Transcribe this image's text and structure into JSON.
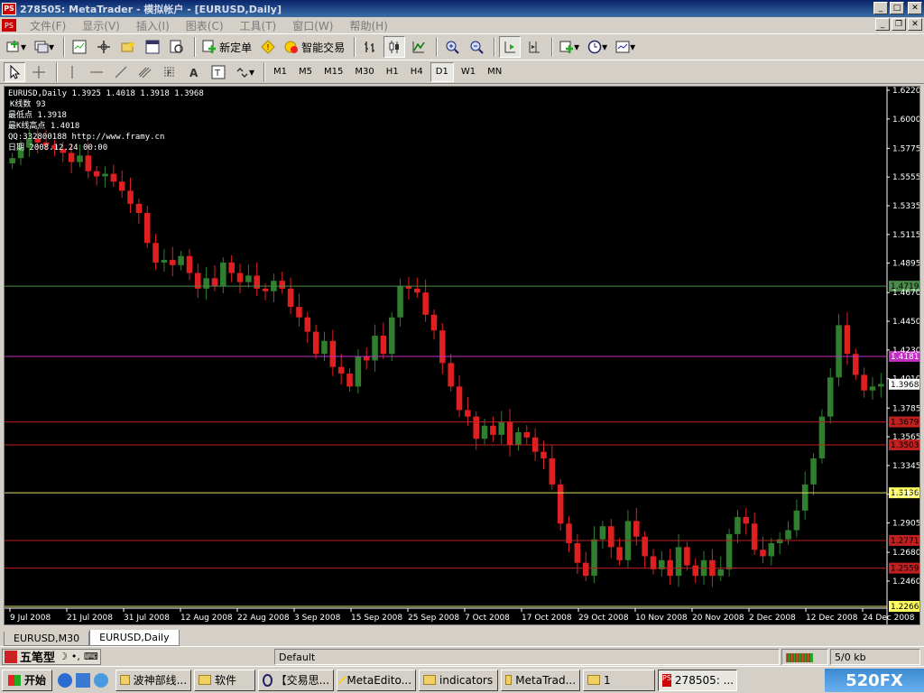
{
  "window": {
    "title": "278505: MetaTrader - 模拟帐户 - [EURUSD,Daily]",
    "app_badge": "PS"
  },
  "menu": [
    "文件(F)",
    "显示(V)",
    "插入(I)",
    "图表(C)",
    "工具(T)",
    "窗口(W)",
    "帮助(H)"
  ],
  "toolbar": {
    "new_order_label": "新定单",
    "expert_label": "智能交易"
  },
  "timeframes": [
    "M1",
    "M5",
    "M15",
    "M30",
    "H1",
    "H4",
    "D1",
    "W1",
    "MN"
  ],
  "active_timeframe": "D1",
  "chart_info": {
    "line1": "EURUSD,Daily  1.3925 1.4018 1.3918 1.3968",
    "line2": "K线数   93",
    "line3": " 最低点 1.3918",
    "line4": " 最K线高点 1.4018",
    "line5": "QQ:332800188 http://www.framy.cn",
    "line6": "日期 2008.12.24 00:00"
  },
  "price_axis": [
    "1.6220",
    "1.6000",
    "1.5775",
    "1.5555",
    "1.5335",
    "1.5115",
    "1.4895",
    "1.4670",
    "1.4450",
    "1.4230",
    "1.4010",
    "1.3785",
    "1.3565",
    "1.3345",
    "1.3125",
    "1.2905",
    "1.2680",
    "1.2460"
  ],
  "date_axis": [
    "9 Jul 2008",
    "21 Jul 2008",
    "31 Jul 2008",
    "12 Aug 2008",
    "22 Aug 2008",
    "3 Sep 2008",
    "15 Sep 2008",
    "25 Sep 2008",
    "7 Oct 2008",
    "17 Oct 2008",
    "29 Oct 2008",
    "10 Nov 2008",
    "20 Nov 2008",
    "2 Dec 2008",
    "12 Dec 2008",
    "24 Dec 2008"
  ],
  "levels": [
    {
      "price": "1.4719",
      "color": "#4a8a4a",
      "label_bg": "#4a8a4a",
      "label_fg": "#000"
    },
    {
      "price": "1.4181",
      "color": "#c030c0",
      "label_bg": "#c030c0",
      "label_fg": "#fff"
    },
    {
      "price": "1.3679",
      "color": "#c02020",
      "label_bg": "#c02020",
      "label_fg": "#000"
    },
    {
      "price": "1.3503",
      "color": "#c02020",
      "label_bg": "#c02020",
      "label_fg": "#000"
    },
    {
      "price": "1.3136",
      "color": "#e0e060",
      "label_bg": "#ffff60",
      "label_fg": "#000"
    },
    {
      "price": "1.2771",
      "color": "#c02020",
      "label_bg": "#c02020",
      "label_fg": "#000"
    },
    {
      "price": "1.2559",
      "color": "#c02020",
      "label_bg": "#c02020",
      "label_fg": "#000"
    },
    {
      "price": "1.2266",
      "color": "#e0e060",
      "label_bg": "#ffff60",
      "label_fg": "#000"
    }
  ],
  "current_price": "1.3968",
  "tabs": [
    "EURUSD,M30",
    "EURUSD,Daily"
  ],
  "active_tab": "EURUSD,Daily",
  "status": {
    "ime": "五笔型",
    "profile": "Default",
    "traffic": "5/0 kb"
  },
  "taskbar": {
    "start": "开始",
    "items": [
      "波神部线...",
      "软件",
      "【交易思...",
      "MetaEdito...",
      "indicators",
      "MetaTrad...",
      "1",
      "278505: ..."
    ],
    "active_index": 7,
    "tray_logo": "520FX"
  },
  "colors": {
    "bull": "#2f7f2f",
    "bear": "#e02020",
    "chart_bg": "#000000"
  }
}
